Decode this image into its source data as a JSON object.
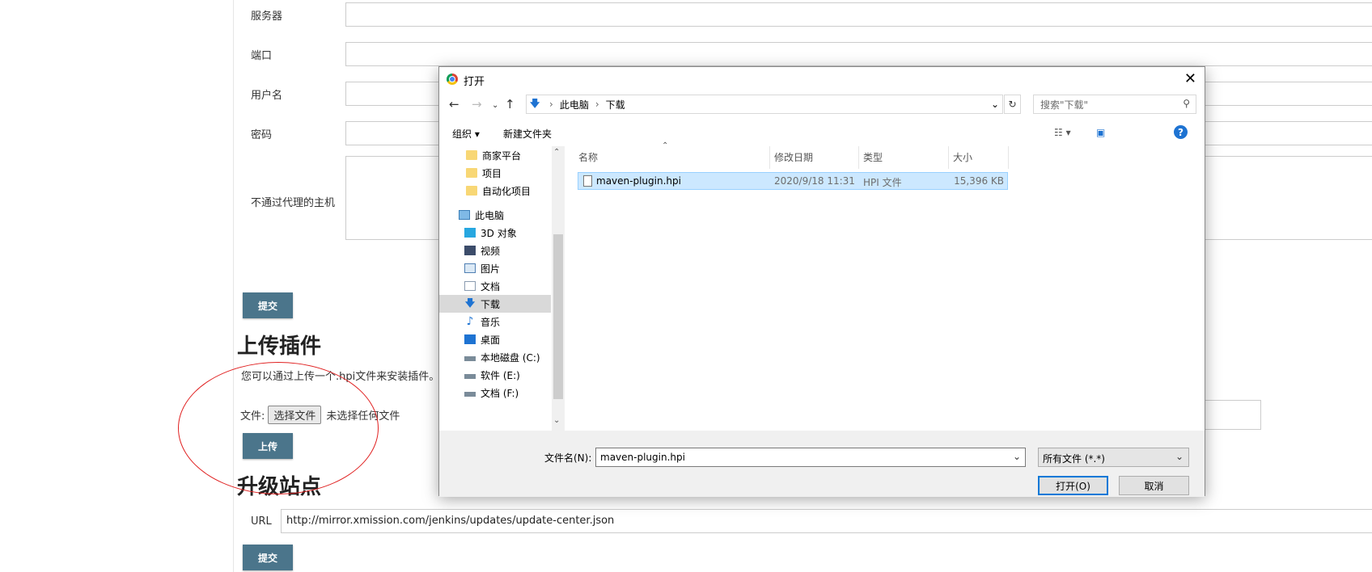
{
  "form": {
    "server_label": "服务器",
    "port_label": "端口",
    "username_label": "用户名",
    "password_label": "密码",
    "noproxy_label": "不通过代理的主机",
    "submit_label": "提交"
  },
  "upload": {
    "heading": "上传插件",
    "description": "您可以通过上传一个.hpi文件来安装插件。",
    "file_label": "文件:",
    "choose_label": "选择文件",
    "no_file_text": "未选择任何文件",
    "upload_label": "上传"
  },
  "update_site": {
    "heading": "升级站点",
    "url_label": "URL",
    "url_value": "http://mirror.xmission.com/jenkins/updates/update-center.json",
    "submit_label": "提交"
  },
  "dialog": {
    "title": "打开",
    "close": "✕",
    "breadcrumb": [
      "此电脑",
      "下载"
    ],
    "search_placeholder": "搜索\"下载\"",
    "organize_label": "组织 ▾",
    "new_folder_label": "新建文件夹",
    "nav_items": [
      {
        "label": "商家平台",
        "icon": "folder-icon"
      },
      {
        "label": "项目",
        "icon": "folder-icon"
      },
      {
        "label": "自动化项目",
        "icon": "folder-icon"
      },
      {
        "label": "此电脑",
        "icon": "pc-icon"
      },
      {
        "label": "3D 对象",
        "icon": "3d-objects-icon"
      },
      {
        "label": "视频",
        "icon": "video-icon"
      },
      {
        "label": "图片",
        "icon": "pictures-icon"
      },
      {
        "label": "文档",
        "icon": "documents-icon"
      },
      {
        "label": "下载",
        "icon": "download-icon"
      },
      {
        "label": "音乐",
        "icon": "music-icon"
      },
      {
        "label": "桌面",
        "icon": "desktop-icon"
      },
      {
        "label": "本地磁盘 (C:)",
        "icon": "drive-icon"
      },
      {
        "label": "软件 (E:)",
        "icon": "drive-icon"
      },
      {
        "label": "文档 (F:)",
        "icon": "drive-icon"
      }
    ],
    "columns": {
      "name": "名称",
      "date": "修改日期",
      "type": "类型",
      "size": "大小"
    },
    "file": {
      "name": "maven-plugin.hpi",
      "date": "2020/9/18 11:31",
      "type": "HPI 文件",
      "size": "15,396 KB"
    },
    "filename_label": "文件名(N):",
    "filename_value": "maven-plugin.hpi",
    "filetype_value": "所有文件 (*.*)",
    "open_label": "打开(O)",
    "cancel_label": "取消"
  },
  "colors": {
    "jenkins_button": "#4b758b",
    "selection": "#cce8ff",
    "annotation": "#e02020"
  }
}
